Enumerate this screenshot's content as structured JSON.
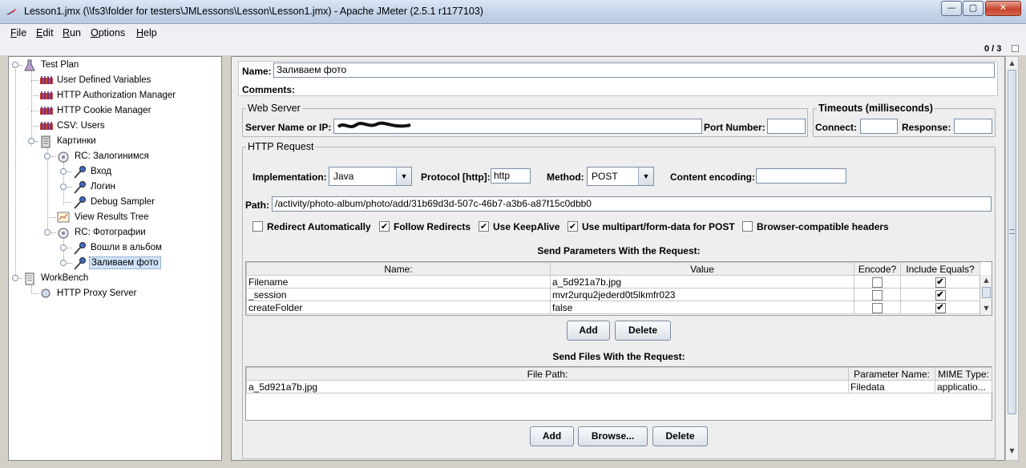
{
  "window": {
    "title": "Lesson1.jmx (\\\\fs3\\folder for testers\\JMLessons\\Lesson\\Lesson1.jmx) - Apache JMeter (2.5.1 r1177103)",
    "minimize": "—",
    "maximize": "▢",
    "close": "✕"
  },
  "menu": [
    {
      "key": "F",
      "rest": "ile"
    },
    {
      "key": "E",
      "rest": "dit"
    },
    {
      "key": "R",
      "rest": "un"
    },
    {
      "key": "O",
      "rest": "ptions"
    },
    {
      "key": "H",
      "rest": "elp"
    }
  ],
  "toolbar": {
    "counter": "0 / 3"
  },
  "tree": {
    "nodes": [
      {
        "label": "Test Plan",
        "icon": "flask-icon"
      },
      {
        "label": "User Defined Variables",
        "icon": "config-element-icon"
      },
      {
        "label": "HTTP Authorization Manager",
        "icon": "config-element-icon"
      },
      {
        "label": "HTTP Cookie Manager",
        "icon": "config-element-icon"
      },
      {
        "label": "CSV: Users",
        "icon": "config-element-icon"
      },
      {
        "label": "Картинки",
        "icon": "thread-group-icon"
      },
      {
        "label": "RC: Залогинимся",
        "icon": "controller-icon"
      },
      {
        "label": "Вход",
        "icon": "sampler-icon"
      },
      {
        "label": "Логин",
        "icon": "sampler-icon"
      },
      {
        "label": "Debug Sampler",
        "icon": "sampler-icon"
      },
      {
        "label": "View Results Tree",
        "icon": "listener-icon"
      },
      {
        "label": "RC: Фотографии",
        "icon": "controller-icon"
      },
      {
        "label": "Вошли в альбом",
        "icon": "sampler-icon"
      },
      {
        "label": "Заливаем фото",
        "icon": "sampler-icon"
      },
      {
        "label": "WorkBench",
        "icon": "workbench-icon"
      },
      {
        "label": "HTTP Proxy Server",
        "icon": "proxy-icon"
      }
    ]
  },
  "sampler": {
    "name_label": "Name:",
    "name_value": "Заливаем фото",
    "comments_label": "Comments:",
    "web_server": {
      "title": "Web Server",
      "server_label": "Server Name or IP:",
      "port_label": "Port Number:",
      "port_value": ""
    },
    "timeouts": {
      "title": "Timeouts (milliseconds)",
      "connect_label": "Connect:",
      "response_label": "Response:"
    },
    "http_request": {
      "title": "HTTP Request",
      "implementation_label": "Implementation:",
      "implementation_value": "Java",
      "protocol_label": "Protocol [http]:",
      "protocol_value": "http",
      "method_label": "Method:",
      "method_value": "POST",
      "encoding_label": "Content encoding:",
      "encoding_value": "",
      "path_label": "Path:",
      "path_value": "/activity/photo-album/photo/add/31b69d3d-507c-46b7-a3b6-a87f15c0dbb0"
    },
    "options": [
      {
        "label": "Redirect Automatically",
        "checked": false
      },
      {
        "label": "Follow Redirects",
        "checked": true
      },
      {
        "label": "Use KeepAlive",
        "checked": true
      },
      {
        "label": "Use multipart/form-data for POST",
        "checked": true
      },
      {
        "label": "Browser-compatible headers",
        "checked": false
      }
    ],
    "params": {
      "title": "Send Parameters With the Request:",
      "columns": [
        "Name:",
        "Value",
        "Encode?",
        "Include Equals?"
      ],
      "rows": [
        {
          "name": "Filename",
          "value": "a_5d921a7b.jpg",
          "encode": false,
          "include_equals": true
        },
        {
          "name": "_session",
          "value": "mvr2urqu2jederd0t5lkmfr023",
          "encode": false,
          "include_equals": true
        },
        {
          "name": "createFolder",
          "value": "false",
          "encode": false,
          "include_equals": true
        }
      ],
      "add": "Add",
      "delete": "Delete"
    },
    "files": {
      "title": "Send Files With the Request:",
      "columns": [
        "File Path:",
        "Parameter Name:",
        "MIME Type:"
      ],
      "rows": [
        {
          "path": "a_5d921a7b.jpg",
          "param": "Filedata",
          "mime": "applicatio..."
        }
      ],
      "add": "Add",
      "browse": "Browse...",
      "delete": "Delete"
    }
  }
}
